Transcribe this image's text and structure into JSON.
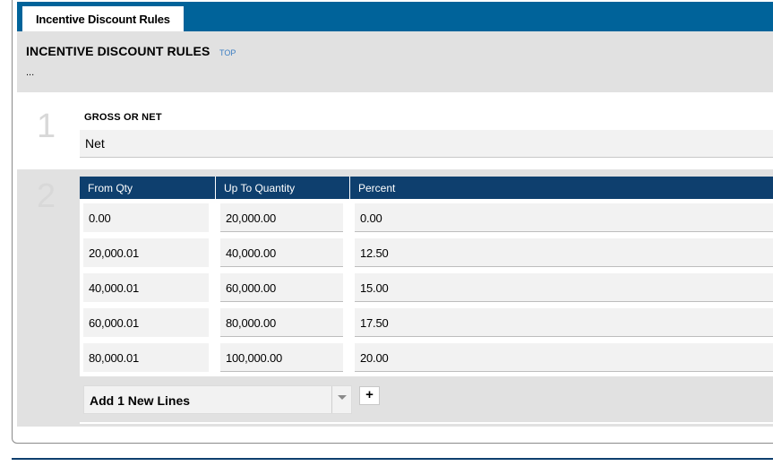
{
  "tab": {
    "label": "Incentive Discount Rules"
  },
  "header": {
    "title": "INCENTIVE DISCOUNT RULES",
    "top_link": "TOP",
    "ellipsis": "..."
  },
  "section1": {
    "number": "1",
    "label": "GROSS OR NET",
    "value": "Net"
  },
  "section2": {
    "number": "2",
    "columns": [
      "From Qty",
      "Up To Quantity",
      "Percent"
    ],
    "rows": [
      [
        "0.00",
        "20,000.00",
        "0.00"
      ],
      [
        "20,000.01",
        "40,000.00",
        "12.50"
      ],
      [
        "40,000.01",
        "60,000.00",
        "15.00"
      ],
      [
        "60,000.01",
        "80,000.00",
        "17.50"
      ],
      [
        "80,000.01",
        "100,000.00",
        "20.00"
      ]
    ],
    "add_select": "Add 1 New Lines",
    "add_button": "+"
  },
  "colors": {
    "tabbar": "#00639a",
    "grid_header": "#0e3f6e",
    "panel": "#e1e1e1",
    "field": "#f2f2f2",
    "link": "#3c7ec2"
  },
  "icons": {
    "select_arrow": "chevron-down-icon",
    "add": "plus-icon"
  }
}
